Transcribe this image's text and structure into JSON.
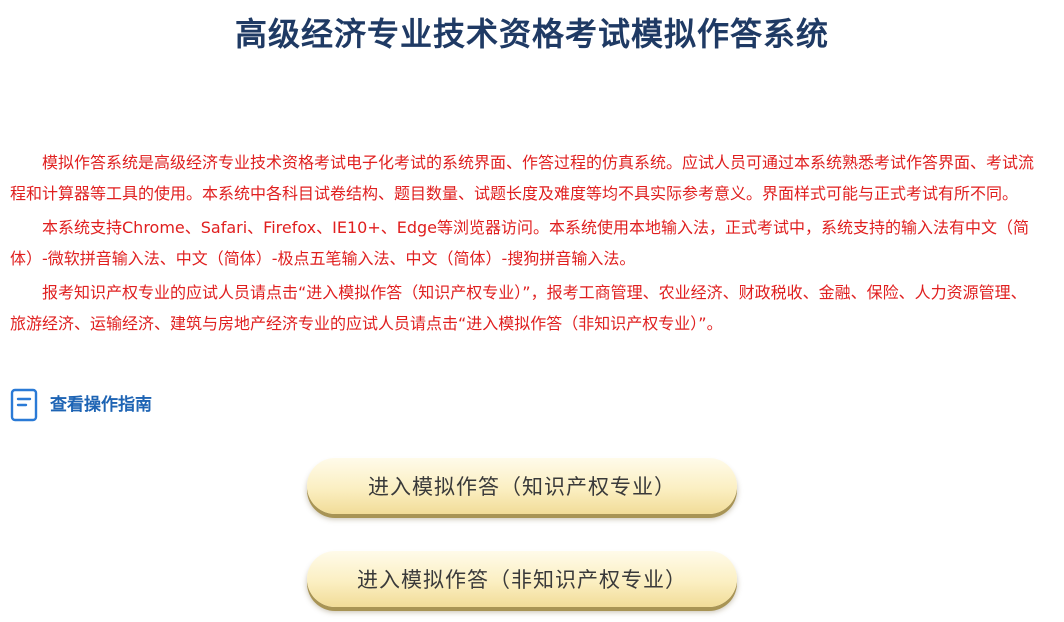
{
  "header": {
    "title": "高级经济专业技术资格考试模拟作答系统"
  },
  "notice": {
    "paragraphs": [
      "模拟作答系统是高级经济专业技术资格考试电子化考试的系统界面、作答过程的仿真系统。应试人员可通过本系统熟悉考试作答界面、考试流程和计算器等工具的使用。本系统中各科目试卷结构、题目数量、试题长度及难度等均不具实际参考意义。界面样式可能与正式考试有所不同。",
      "本系统支持Chrome、Safari、Firefox、IE10+、Edge等浏览器访问。本系统使用本地输入法，正式考试中，系统支持的输入法有中文（简体）-微软拼音输入法、中文（简体）-极点五笔输入法、中文（简体）-搜狗拼音输入法。",
      "报考知识产权专业的应试人员请点击“进入模拟作答（知识产权专业）”，报考工商管理、农业经济、财政税收、金融、保险、人力资源管理、旅游经济、运输经济、建筑与房地产经济专业的应试人员请点击“进入模拟作答（非知识产权专业）”。"
    ],
    "text_color": "#e01f1f"
  },
  "guide": {
    "label": "查看操作指南",
    "icon": "document-icon",
    "color": "#1e64b4"
  },
  "buttons": {
    "ip_label": "进入模拟作答（知识产权专业）",
    "non_ip_label": "进入模拟作答（非知识产权专业）"
  },
  "colors": {
    "title": "#1f3a64",
    "button_gold": "#f1dc98"
  }
}
